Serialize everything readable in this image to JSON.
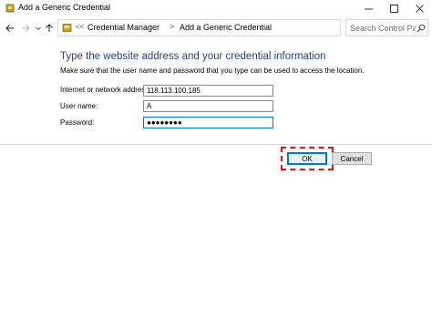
{
  "window": {
    "title": "Add a Generic Credential"
  },
  "nav": {
    "address_chevron": "<<",
    "breadcrumbs": [
      "Credential Manager",
      "Add a Generic Credential"
    ],
    "breadcrumb_separator": ">",
    "search_placeholder": "Search Control Panel"
  },
  "form": {
    "heading": "Type the website address and your credential information",
    "description": "Make sure that the user name and password that you type can be used to access the location.",
    "address_label": "Internet or network address:",
    "address_value": "118.113.100.185",
    "username_label": "User name:",
    "username_value": "A",
    "password_label": "Password:",
    "password_value": "●●●●●●●●"
  },
  "buttons": {
    "ok": "OK",
    "cancel": "Cancel"
  },
  "colors": {
    "heading": "#1e3f9e",
    "highlight": "#e8141b",
    "focus": "#0078d7"
  }
}
